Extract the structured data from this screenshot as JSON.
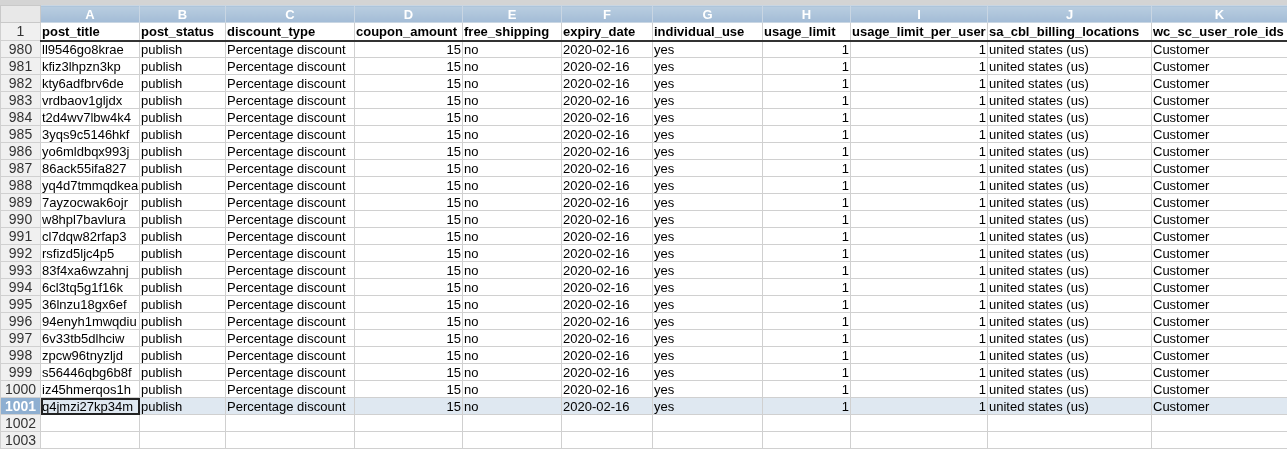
{
  "columns": [
    {
      "letter": "A",
      "header": "post_title",
      "kind": "text"
    },
    {
      "letter": "B",
      "header": "post_status",
      "kind": "text"
    },
    {
      "letter": "C",
      "header": "discount_type",
      "kind": "text"
    },
    {
      "letter": "D",
      "header": "coupon_amount",
      "kind": "number"
    },
    {
      "letter": "E",
      "header": "free_shipping",
      "kind": "text"
    },
    {
      "letter": "F",
      "header": "expiry_date",
      "kind": "text"
    },
    {
      "letter": "G",
      "header": "individual_use",
      "kind": "text"
    },
    {
      "letter": "H",
      "header": "usage_limit",
      "kind": "number"
    },
    {
      "letter": "I",
      "header": "usage_limit_per_user",
      "kind": "number"
    },
    {
      "letter": "J",
      "header": "sa_cbl_billing_locations",
      "kind": "text"
    },
    {
      "letter": "K",
      "header": "wc_sc_user_role_ids",
      "kind": "text"
    }
  ],
  "header_row": "1",
  "rows": [
    {
      "number": "980",
      "selected": false,
      "cells": [
        "ll9546go8krae",
        "publish",
        "Percentage discount",
        "15",
        "no",
        "2020-02-16",
        "yes",
        "1",
        "1",
        "united states (us)",
        "Customer"
      ]
    },
    {
      "number": "981",
      "selected": false,
      "cells": [
        "kfiz3lhpzn3kp",
        "publish",
        "Percentage discount",
        "15",
        "no",
        "2020-02-16",
        "yes",
        "1",
        "1",
        "united states (us)",
        "Customer"
      ]
    },
    {
      "number": "982",
      "selected": false,
      "cells": [
        "kty6adfbrv6de",
        "publish",
        "Percentage discount",
        "15",
        "no",
        "2020-02-16",
        "yes",
        "1",
        "1",
        "united states (us)",
        "Customer"
      ]
    },
    {
      "number": "983",
      "selected": false,
      "cells": [
        "vrdbaov1gljdx",
        "publish",
        "Percentage discount",
        "15",
        "no",
        "2020-02-16",
        "yes",
        "1",
        "1",
        "united states (us)",
        "Customer"
      ]
    },
    {
      "number": "984",
      "selected": false,
      "cells": [
        "t2d4wv7lbw4k4",
        "publish",
        "Percentage discount",
        "15",
        "no",
        "2020-02-16",
        "yes",
        "1",
        "1",
        "united states (us)",
        "Customer"
      ]
    },
    {
      "number": "985",
      "selected": false,
      "cells": [
        "3yqs9c5146hkf",
        "publish",
        "Percentage discount",
        "15",
        "no",
        "2020-02-16",
        "yes",
        "1",
        "1",
        "united states (us)",
        "Customer"
      ]
    },
    {
      "number": "986",
      "selected": false,
      "cells": [
        "yo6mldbqx993j",
        "publish",
        "Percentage discount",
        "15",
        "no",
        "2020-02-16",
        "yes",
        "1",
        "1",
        "united states (us)",
        "Customer"
      ]
    },
    {
      "number": "987",
      "selected": false,
      "cells": [
        "86ack55ifa827",
        "publish",
        "Percentage discount",
        "15",
        "no",
        "2020-02-16",
        "yes",
        "1",
        "1",
        "united states (us)",
        "Customer"
      ]
    },
    {
      "number": "988",
      "selected": false,
      "cells": [
        "yq4d7tmmqdkea",
        "publish",
        "Percentage discount",
        "15",
        "no",
        "2020-02-16",
        "yes",
        "1",
        "1",
        "united states (us)",
        "Customer"
      ]
    },
    {
      "number": "989",
      "selected": false,
      "cells": [
        "7ayzocwak6ojr",
        "publish",
        "Percentage discount",
        "15",
        "no",
        "2020-02-16",
        "yes",
        "1",
        "1",
        "united states (us)",
        "Customer"
      ]
    },
    {
      "number": "990",
      "selected": false,
      "cells": [
        "w8hpl7bavlura",
        "publish",
        "Percentage discount",
        "15",
        "no",
        "2020-02-16",
        "yes",
        "1",
        "1",
        "united states (us)",
        "Customer"
      ]
    },
    {
      "number": "991",
      "selected": false,
      "cells": [
        "cl7dqw82rfap3",
        "publish",
        "Percentage discount",
        "15",
        "no",
        "2020-02-16",
        "yes",
        "1",
        "1",
        "united states (us)",
        "Customer"
      ]
    },
    {
      "number": "992",
      "selected": false,
      "cells": [
        "rsfizd5ljc4p5",
        "publish",
        "Percentage discount",
        "15",
        "no",
        "2020-02-16",
        "yes",
        "1",
        "1",
        "united states (us)",
        "Customer"
      ]
    },
    {
      "number": "993",
      "selected": false,
      "cells": [
        "83f4xa6wzahnj",
        "publish",
        "Percentage discount",
        "15",
        "no",
        "2020-02-16",
        "yes",
        "1",
        "1",
        "united states (us)",
        "Customer"
      ]
    },
    {
      "number": "994",
      "selected": false,
      "cells": [
        "6cl3tq5g1f16k",
        "publish",
        "Percentage discount",
        "15",
        "no",
        "2020-02-16",
        "yes",
        "1",
        "1",
        "united states (us)",
        "Customer"
      ]
    },
    {
      "number": "995",
      "selected": false,
      "cells": [
        "36lnzu18gx6ef",
        "publish",
        "Percentage discount",
        "15",
        "no",
        "2020-02-16",
        "yes",
        "1",
        "1",
        "united states (us)",
        "Customer"
      ]
    },
    {
      "number": "996",
      "selected": false,
      "cells": [
        "94enyh1mwqdiu",
        "publish",
        "Percentage discount",
        "15",
        "no",
        "2020-02-16",
        "yes",
        "1",
        "1",
        "united states (us)",
        "Customer"
      ]
    },
    {
      "number": "997",
      "selected": false,
      "cells": [
        "6v33tb5dlhciw",
        "publish",
        "Percentage discount",
        "15",
        "no",
        "2020-02-16",
        "yes",
        "1",
        "1",
        "united states (us)",
        "Customer"
      ]
    },
    {
      "number": "998",
      "selected": false,
      "cells": [
        "zpcw96tnyzljd",
        "publish",
        "Percentage discount",
        "15",
        "no",
        "2020-02-16",
        "yes",
        "1",
        "1",
        "united states (us)",
        "Customer"
      ]
    },
    {
      "number": "999",
      "selected": false,
      "cells": [
        "s56446qbg6b8f",
        "publish",
        "Percentage discount",
        "15",
        "no",
        "2020-02-16",
        "yes",
        "1",
        "1",
        "united states (us)",
        "Customer"
      ]
    },
    {
      "number": "1000",
      "selected": false,
      "cells": [
        "iz45hmerqos1h",
        "publish",
        "Percentage discount",
        "15",
        "no",
        "2020-02-16",
        "yes",
        "1",
        "1",
        "united states (us)",
        "Customer"
      ]
    },
    {
      "number": "1001",
      "selected": true,
      "active_cell": true,
      "cells": [
        "q4jmzi27kp34m",
        "publish",
        "Percentage discount",
        "15",
        "no",
        "2020-02-16",
        "yes",
        "1",
        "1",
        "united states (us)",
        "Customer"
      ]
    },
    {
      "number": "1002",
      "selected": false,
      "cells": []
    },
    {
      "number": "1003",
      "selected": false,
      "cells": []
    }
  ]
}
